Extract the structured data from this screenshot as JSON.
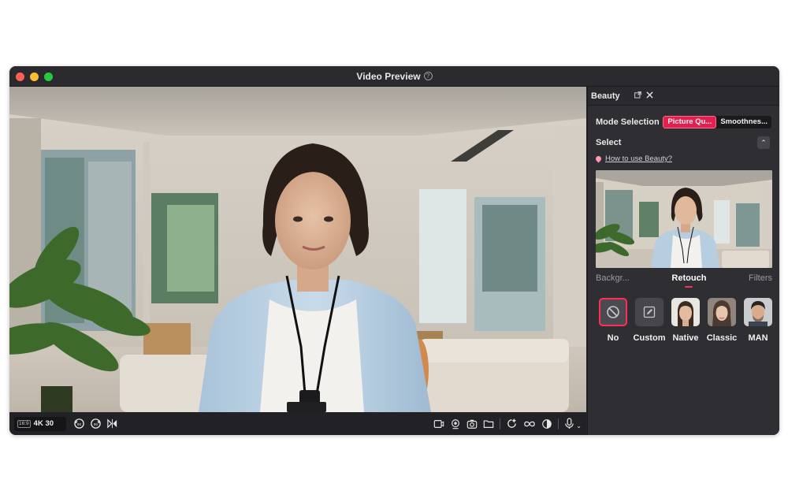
{
  "window": {
    "title": "Video Preview"
  },
  "controls": {
    "ratio_badge": "16:9",
    "resolution": "4K 30"
  },
  "panel": {
    "title": "Beauty",
    "mode_label": "Mode Selection",
    "mode_options": [
      "Picture Qu...",
      "Smoothnes..."
    ],
    "select_label": "Select",
    "howto_link": "How to use Beauty?",
    "tabs": [
      "Backgr...",
      "Retouch",
      "Filters"
    ],
    "presets": [
      "No",
      "Custom",
      "Native",
      "Classic",
      "MAN"
    ]
  },
  "colors": {
    "accent": "#e0204e",
    "panel_bg": "#2e2e33",
    "toolbar_bg": "#222226"
  }
}
